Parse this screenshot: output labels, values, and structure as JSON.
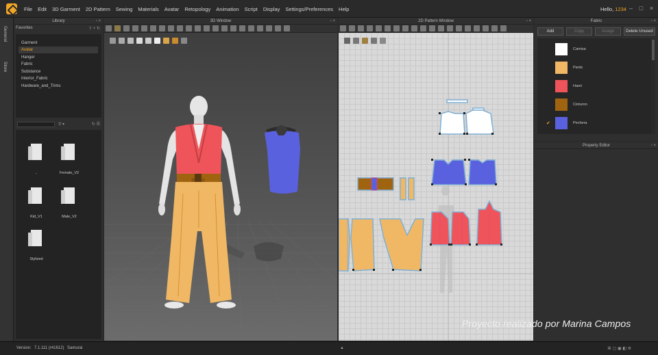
{
  "menubar": {
    "items": [
      "File",
      "Edit",
      "3D Garment",
      "2D Pattern",
      "Sewing",
      "Materials",
      "Avatar",
      "Retopology",
      "Animation",
      "Script",
      "Display",
      "Settings/Preferences",
      "Help"
    ],
    "greeting": "Hello,",
    "user": "1234"
  },
  "sidetabs": [
    "General",
    "Store"
  ],
  "library": {
    "title": "Library",
    "favorites_label": "Favorites",
    "favorites": [
      "Garment",
      "Avatar",
      "Hanger",
      "Fabric",
      "Substance",
      "Interior_Fabric",
      "Hardware_and_Trims"
    ],
    "selected": "Avatar",
    "folders": [
      "..",
      "Female_V2",
      "Kid_V1",
      "Male_V2",
      "Stylized"
    ]
  },
  "window3d": {
    "title": "3D Window"
  },
  "window2d": {
    "title": "2D Pattern Window"
  },
  "fabric": {
    "title": "Fabric",
    "buttons": [
      "Add",
      "Copy",
      "Assign",
      "Delete Unused"
    ],
    "items": [
      {
        "name": "Camisa",
        "color": "#ffffff",
        "checked": false
      },
      {
        "name": "Pants",
        "color": "#f0b865",
        "checked": false
      },
      {
        "name": "Haori",
        "color": "#ee545a",
        "checked": false
      },
      {
        "name": "Cinturon",
        "color": "#a06411",
        "checked": false
      },
      {
        "name": "Pechera",
        "color": "#5a61de",
        "checked": true
      }
    ]
  },
  "property_editor": {
    "title": "Property Editor"
  },
  "status": {
    "version_label": "Version:",
    "version": "7.1.111 (r41612)",
    "project": "Samurai"
  },
  "credit": "Proyecto realizado por Marina Campos",
  "colors": {
    "accent": "#f2a626",
    "red": "#ee545a",
    "blue": "#5a61de",
    "pants": "#f0b865",
    "belt": "#a06411"
  }
}
